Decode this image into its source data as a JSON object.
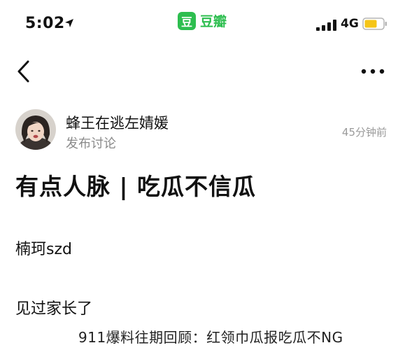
{
  "status_bar": {
    "time": "5:02",
    "network": "4G",
    "app_logo_char": "豆",
    "app_name": "豆瓣",
    "icons": [
      "location-arrow-icon",
      "signal-bars-icon",
      "battery-icon"
    ],
    "battery_color": "#f5c518"
  },
  "nav": {
    "back_icon": "chevron-left-icon",
    "more_icon": "more-dots-icon"
  },
  "post": {
    "author_name": "蜂王在逃左婧媛",
    "author_action": "发布讨论",
    "time_ago": "45分钟前",
    "title": "有点人脉 | 吃瓜不信瓜",
    "paragraphs": [
      "楠珂szd",
      "见过家长了"
    ]
  },
  "caption": "911爆料往期回顾：红领巾瓜报吃瓜不NG",
  "colors": {
    "brand_green": "#2dbe4f",
    "secondary_text": "#8a8a8a"
  }
}
